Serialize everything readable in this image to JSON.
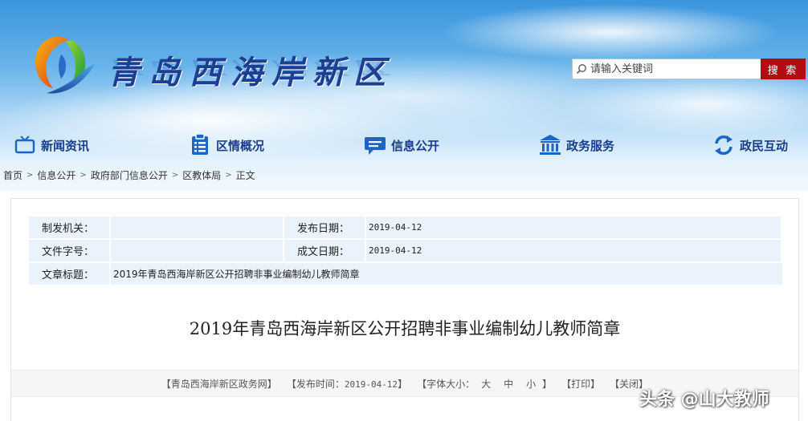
{
  "header": {
    "site_title": "青岛西海岸新区",
    "search": {
      "placeholder": "请输入关键词",
      "button_label": "搜 索"
    }
  },
  "nav": {
    "items": [
      {
        "label": "新闻资讯",
        "icon": "tv-icon"
      },
      {
        "label": "区情概况",
        "icon": "document-list-icon"
      },
      {
        "label": "信息公开",
        "icon": "chat-bubble-icon"
      },
      {
        "label": "政务服务",
        "icon": "government-building-icon"
      },
      {
        "label": "政民互动",
        "icon": "refresh-arrows-icon"
      }
    ]
  },
  "breadcrumb": [
    "首页",
    "信息公开",
    "政府部门信息公开",
    "区教体局",
    "正文"
  ],
  "meta": {
    "issuer_label": "制发机关：",
    "issuer_value": "",
    "publish_date_label": "发布日期：",
    "publish_date_value": "2019-04-12",
    "doc_number_label": "文件字号：",
    "doc_number_value": "",
    "written_date_label": "成文日期：",
    "written_date_value": "2019-04-12",
    "title_label": "文章标题：",
    "title_value": "2019年青岛西海岸新区公开招聘非事业编制幼儿教师简章"
  },
  "article": {
    "title": "2019年青岛西海岸新区公开招聘非事业编制幼儿教师简章"
  },
  "toolbar": {
    "source": "【青岛西海岸新区政务网】",
    "publish_time_prefix": "【发布时间：",
    "publish_time_value": "2019-04-12",
    "publish_time_suffix": "】",
    "font_size_prefix": "【字体大小：",
    "font_large": "大",
    "font_medium": "中",
    "font_small": "小",
    "font_size_suffix": "】",
    "print": "【打印】",
    "close": "【关闭】"
  },
  "watermark": "头条 @山大教师",
  "colors": {
    "nav_text": "#1a3c8c",
    "search_button": "#b20d12",
    "meta_background": "#eaf3fb",
    "title_text": "#1b3f93"
  }
}
